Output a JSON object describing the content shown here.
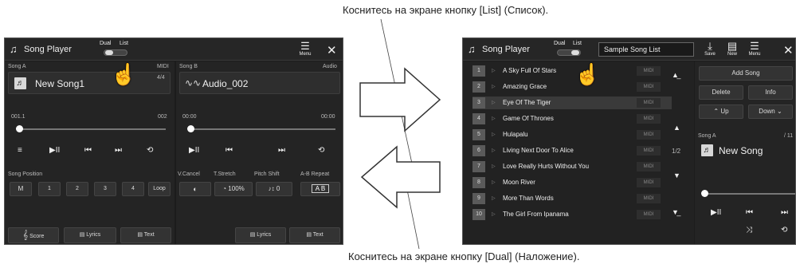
{
  "captions": {
    "top": "Коснитесь на экране кнопку [List] (Список).",
    "bottom": "Коснитесь на экране кнопку [Dual] (Наложение)."
  },
  "left": {
    "title": "Song Player",
    "dual": "Dual",
    "list": "List",
    "menu": "Menu",
    "songA": {
      "label": "Song A",
      "type": "MIDI",
      "name": "New Song1",
      "count": "4/4",
      "pos": "001.1",
      "end": "002"
    },
    "songB": {
      "label": "Song B",
      "type": "Audio",
      "name": "Audio_002",
      "pos": "00:00",
      "end": "00:00"
    },
    "songPosition": "Song Position",
    "markers": [
      "M",
      "1",
      "2",
      "3",
      "4",
      "Loop"
    ],
    "vcancel": "V.Cancel",
    "tstretch": "T.Stretch",
    "pitch": "Pitch Shift",
    "ab": "A-B Repeat",
    "tval": "100%",
    "pval": "0",
    "abval": "A B",
    "score": "Score",
    "lyricsA": "Lyrics",
    "textA": "Text",
    "lyricsB": "Lyrics",
    "textB": "Text"
  },
  "right": {
    "title": "Song Player",
    "dual": "Dual",
    "list": "List",
    "listName": "Sample Song List",
    "save": "Save",
    "new": "New",
    "menu": "Menu",
    "songs": [
      {
        "n": "1",
        "title": "A Sky Full Of Stars",
        "type": "MIDI"
      },
      {
        "n": "2",
        "title": "Amazing Grace",
        "type": "MIDI"
      },
      {
        "n": "3",
        "title": "Eye Of The Tiger",
        "type": "MIDI"
      },
      {
        "n": "4",
        "title": "Game Of Thrones",
        "type": "MIDI"
      },
      {
        "n": "5",
        "title": "Hulapalu",
        "type": "MIDI"
      },
      {
        "n": "6",
        "title": "Living Next Door To Alice",
        "type": "MIDI"
      },
      {
        "n": "7",
        "title": "Love Really Hurts Without You",
        "type": "MIDI"
      },
      {
        "n": "8",
        "title": "Moon River",
        "type": "MIDI"
      },
      {
        "n": "9",
        "title": "More Than Words",
        "type": "MIDI"
      },
      {
        "n": "10",
        "title": "The Girl From Ipanama",
        "type": "MIDI"
      }
    ],
    "page": "1/2",
    "addSong": "Add Song",
    "delete": "Delete",
    "info": "Info",
    "up": "Up",
    "down": "Down",
    "songA": "Song A",
    "count": "/ 11",
    "songName": "New Song"
  }
}
